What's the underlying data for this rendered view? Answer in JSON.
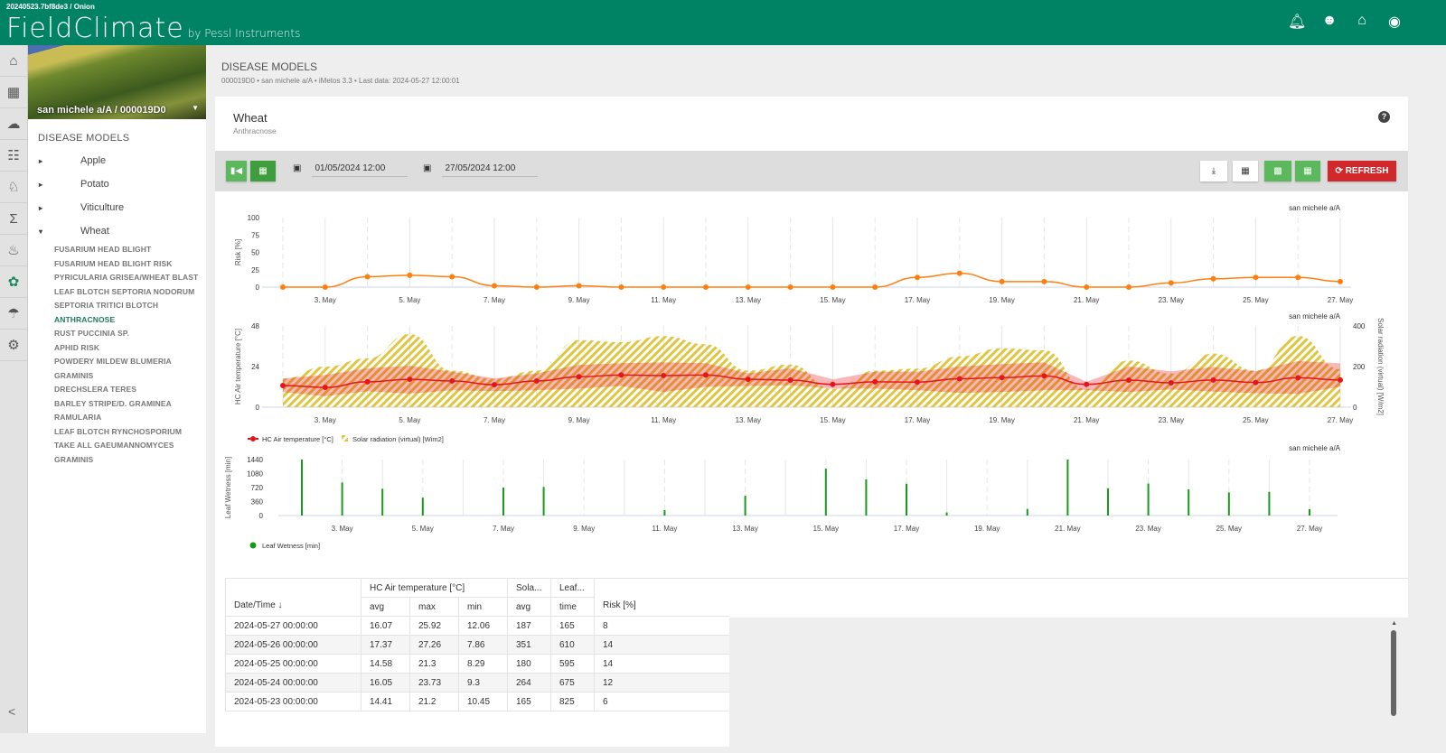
{
  "header": {
    "build": "20240523.7bf8de3 / Onion",
    "logo": "FieldClimate",
    "logo_sub": "by Pessl Instruments",
    "icons": [
      "bell-icon",
      "user-icon",
      "farm-icon",
      "station-signal-icon"
    ]
  },
  "rail": {
    "icons": [
      "home-icon",
      "chart-icon",
      "weather-icon",
      "farmer-icon",
      "animal-icon",
      "sum-icon",
      "thermometer-icon",
      "leaf-icon",
      "irrigation-icon",
      "gear-icon"
    ],
    "collapse": "<"
  },
  "sidebar": {
    "station": "san michele a/A / 000019D0",
    "section": "DISEASE MODELS",
    "crops": [
      {
        "label": "Apple",
        "arrow": "▸"
      },
      {
        "label": "Potato",
        "arrow": "▸"
      },
      {
        "label": "Viticulture",
        "arrow": "▸"
      },
      {
        "label": "Wheat",
        "arrow": "▾"
      }
    ],
    "wheat_models": [
      "FUSARIUM HEAD BLIGHT",
      "FUSARIUM HEAD BLIGHT RISK",
      "PYRICULARIA GRISEA/WHEAT BLAST",
      "LEAF BLOTCH SEPTORIA NODORUM",
      "SEPTORIA TRITICI BLOTCH",
      "ANTHRACNOSE",
      "RUST PUCCINIA SP.",
      "APHID RISK",
      "POWDERY MILDEW BLUMERIA GRAMINIS",
      "DRECHSLERA TERES",
      "BARLEY STRIPE/D. GRAMINEA",
      "RAMULARIA",
      "LEAF BLOTCH RYNCHOSPORIUM",
      "TAKE ALL GAEUMANNOMYCES GRAMINIS"
    ],
    "active_model": "ANTHRACNOSE"
  },
  "page": {
    "title": "DISEASE MODELS",
    "subtitle": "000019D0 • san michele a/A • iMetos 3.3 • Last data: 2024-05-27 12:00:01"
  },
  "card": {
    "title": "Wheat",
    "subtitle": "Anthracnose",
    "help": "?"
  },
  "toolbar": {
    "from": "01/05/2024 12:00",
    "to": "27/05/2024 12:00",
    "refresh": "REFRESH"
  },
  "colors": {
    "brand": "#008265",
    "risk": "#ff7f0e",
    "temp": "#e8141b",
    "solar": "#e0c640",
    "leaf": "#1a9a1a",
    "refresh": "#d0282b"
  },
  "chart_data": [
    {
      "type": "line",
      "station": "san michele a/A",
      "ylabel": "Risk [%]",
      "ylim": [
        0,
        100
      ],
      "yticks": [
        0,
        25,
        50,
        75,
        100
      ],
      "x": [
        "2024-05-02",
        "2024-05-03",
        "2024-05-04",
        "2024-05-05",
        "2024-05-06",
        "2024-05-07",
        "2024-05-08",
        "2024-05-09",
        "2024-05-10",
        "2024-05-11",
        "2024-05-12",
        "2024-05-13",
        "2024-05-14",
        "2024-05-15",
        "2024-05-16",
        "2024-05-17",
        "2024-05-18",
        "2024-05-19",
        "2024-05-20",
        "2024-05-21",
        "2024-05-22",
        "2024-05-23",
        "2024-05-24",
        "2024-05-25",
        "2024-05-26",
        "2024-05-27"
      ],
      "xtick_labels": [
        "3. May",
        "5. May",
        "7. May",
        "9. May",
        "11. May",
        "13. May",
        "15. May",
        "17. May",
        "19. May",
        "21. May",
        "23. May",
        "25. May",
        "27. May"
      ],
      "values": [
        0,
        0,
        15,
        17,
        15,
        2,
        0,
        2,
        0,
        0,
        0,
        0,
        0,
        0,
        0,
        14,
        20,
        8,
        8,
        0,
        0,
        6,
        12,
        14,
        14,
        8
      ]
    },
    {
      "type": "line",
      "station": "san michele a/A",
      "ylabel": "HC Air temperature [°C]",
      "ylim": [
        0,
        48
      ],
      "yticks": [
        0,
        24,
        48
      ],
      "y2label": "Solar radiation (virtual) [W/m2]",
      "y2lim": [
        0,
        400
      ],
      "y2ticks": [
        0,
        200,
        400
      ],
      "series": [
        {
          "name": "HC Air temperature [°C]",
          "avg": [
            12.8,
            11.7,
            15,
            16.5,
            15.5,
            13.3,
            15.5,
            18,
            19,
            18.7,
            19,
            16.5,
            16,
            13.5,
            15,
            14.8,
            16.8,
            17.5,
            18.5,
            13.5,
            16,
            14.41,
            16.05,
            14.58,
            17.37,
            16.07
          ],
          "max": [
            17,
            19,
            23,
            24.5,
            21,
            17,
            20,
            25,
            26,
            26.5,
            26,
            20,
            23,
            16.5,
            21,
            21,
            24,
            25.5,
            26.5,
            15,
            24,
            21.2,
            23.73,
            21.3,
            27.26,
            25.92
          ],
          "min": [
            9,
            6.5,
            9.5,
            8,
            10,
            9.5,
            10,
            11,
            12.5,
            9,
            12,
            12.5,
            13,
            11,
            11,
            10,
            8.5,
            9,
            10,
            10,
            9,
            10.45,
            9.3,
            8.29,
            7.86,
            12.06
          ]
        },
        {
          "name": "Solar radiation (virtual) [Wim2]",
          "values": [
            140,
            200,
            240,
            360,
            180,
            140,
            180,
            330,
            320,
            350,
            310,
            180,
            210,
            90,
            180,
            190,
            250,
            290,
            280,
            90,
            230,
            165,
            264,
            180,
            351,
            187
          ]
        }
      ]
    },
    {
      "type": "bar",
      "station": "san michele a/A",
      "ylabel": "Leaf Wetness [min]",
      "ylim": [
        0,
        1440
      ],
      "yticks": [
        0,
        360,
        720,
        1080,
        1440
      ],
      "series": [
        {
          "name": "Leaf Wetness [min]",
          "values": [
            1440,
            850,
            690,
            460,
            0,
            720,
            735,
            0,
            0,
            140,
            0,
            510,
            0,
            1210,
            930,
            820,
            80,
            0,
            170,
            1440,
            700,
            825,
            675,
            595,
            610,
            165
          ]
        }
      ]
    }
  ],
  "table": {
    "group_headers": [
      "HC Air temperature [°C]",
      "Sola...",
      "Leaf..."
    ],
    "date_header": "Date/Time",
    "sort_icon": "↓",
    "sub_headers": [
      "avg",
      "max",
      "min",
      "avg",
      "time"
    ],
    "risk_header": "Risk [%]",
    "rows": [
      [
        "2024-05-27 00:00:00",
        "16.07",
        "25.92",
        "12.06",
        "187",
        "165",
        "8"
      ],
      [
        "2024-05-26 00:00:00",
        "17.37",
        "27.26",
        "7.86",
        "351",
        "610",
        "14"
      ],
      [
        "2024-05-25 00:00:00",
        "14.58",
        "21.3",
        "8.29",
        "180",
        "595",
        "14"
      ],
      [
        "2024-05-24 00:00:00",
        "16.05",
        "23.73",
        "9.3",
        "264",
        "675",
        "12"
      ],
      [
        "2024-05-23 00:00:00",
        "14.41",
        "21.2",
        "10.45",
        "165",
        "825",
        "6"
      ]
    ]
  }
}
